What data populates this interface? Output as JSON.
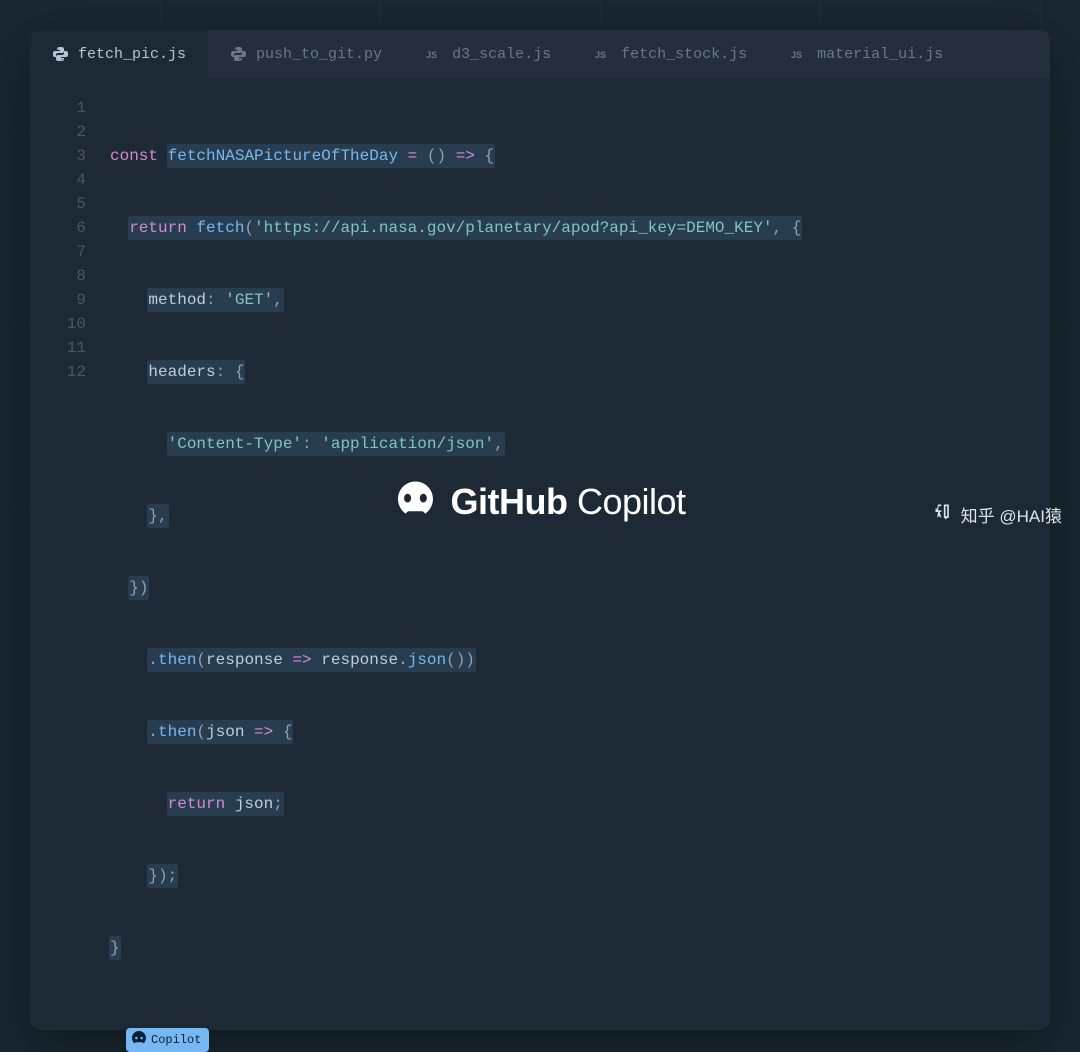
{
  "tabs": [
    {
      "label": "fetch_pic.js",
      "icon": "python",
      "active": true
    },
    {
      "label": "push_to_git.py",
      "icon": "python",
      "active": false
    },
    {
      "label": "d3_scale.js",
      "icon": "js",
      "active": false
    },
    {
      "label": "fetch_stock.js",
      "icon": "js",
      "active": false
    },
    {
      "label": "material_ui.js",
      "icon": "js",
      "active": false
    }
  ],
  "code": {
    "line_count": 12,
    "tokens": {
      "kw_const": "const",
      "fn_name": "fetchNASAPictureOfTheDay",
      "op_assign": "=",
      "parens_empty": "()",
      "op_arrow": "=>",
      "brace_open": "{",
      "kw_return": "return",
      "fn_fetch": "fetch",
      "str_url": "'https://api.nasa.gov/planetary/apod?api_key=DEMO_KEY'",
      "comma": ",",
      "prop_method": "method",
      "colon": ":",
      "str_get": "'GET'",
      "prop_headers": "headers",
      "str_ct": "'Content-Type'",
      "str_json": "'application/json'",
      "brace_close": "}",
      "paren_close": ")",
      "m_then": ".then",
      "p_response": "response",
      "m_json": ".json",
      "p_json": "json",
      "semi": ";"
    }
  },
  "copilot_badge": "Copilot",
  "brand": {
    "bold": "GitHub",
    "light": " Copilot"
  },
  "watermark": "知乎 @HAI猿"
}
